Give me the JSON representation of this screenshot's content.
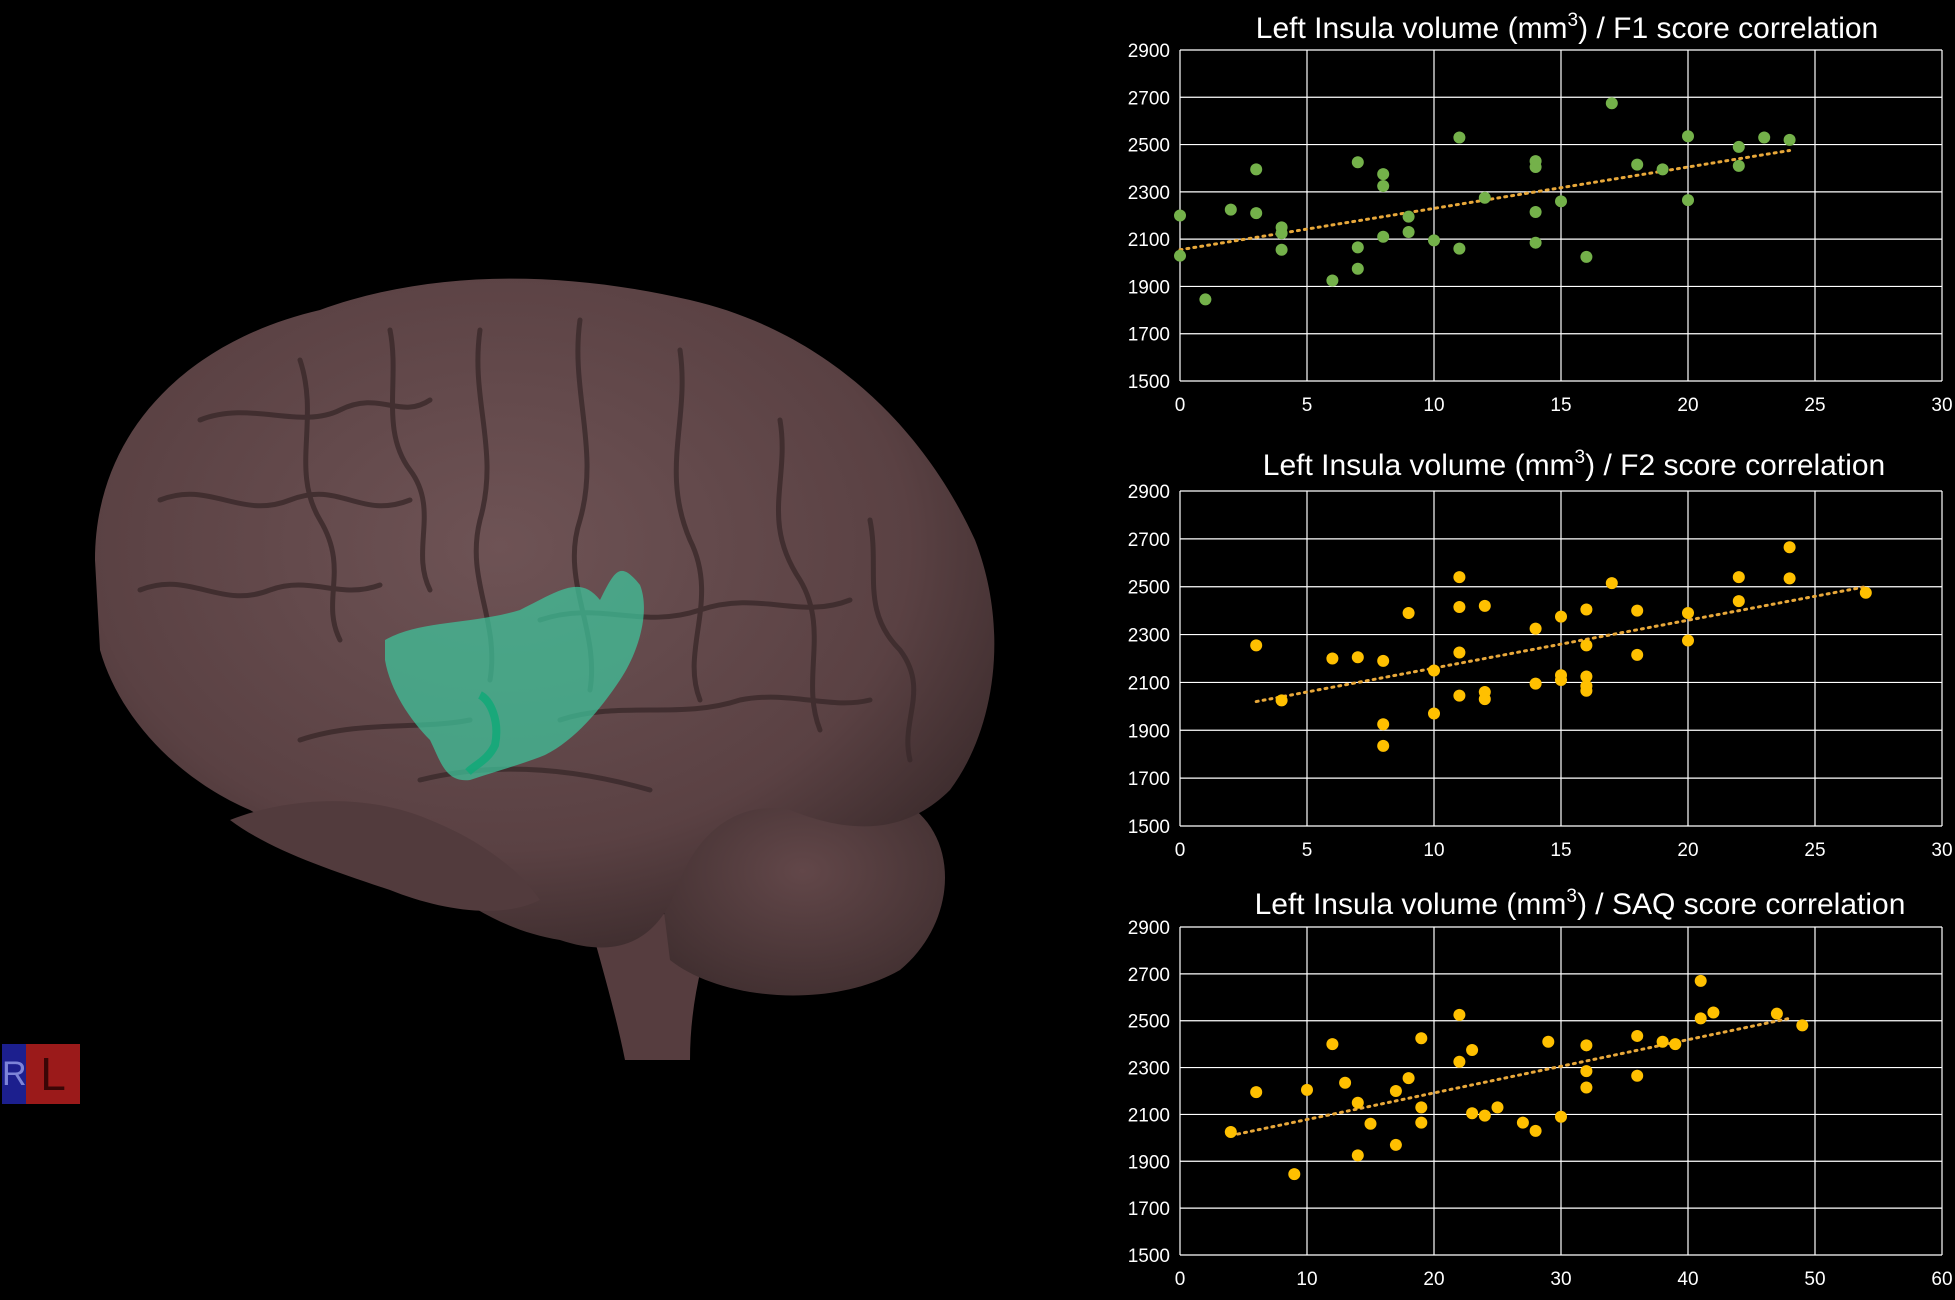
{
  "orientation_marker": {
    "right_letter": "R",
    "left_letter": "L"
  },
  "colors": {
    "background": "#000000",
    "brain": "#5e4446",
    "insula": "#3fc69d",
    "f1_points": "#74b14a",
    "yellow_points": "#ffc000",
    "trendline": "#e8a83a",
    "grid": "#ffffff"
  },
  "chart_data": [
    {
      "type": "scatter",
      "title_text": "Left Insula volume (mm",
      "title_sup": "3",
      "title_rest": ") / F1 score correlation",
      "xlabel": "",
      "ylabel": "",
      "xlim": [
        0,
        30
      ],
      "ylim": [
        1500,
        2900
      ],
      "xticks": [
        0,
        5,
        10,
        15,
        20,
        25,
        30
      ],
      "yticks": [
        1500,
        1700,
        1900,
        2100,
        2300,
        2500,
        2700,
        2900
      ],
      "grid": true,
      "marker_color": "#74b14a",
      "trendline": {
        "style": "dotted",
        "from": [
          0,
          2055
        ],
        "to": [
          24,
          2475
        ]
      },
      "points": [
        [
          0,
          2200
        ],
        [
          0,
          2030
        ],
        [
          1,
          1845
        ],
        [
          2,
          2225
        ],
        [
          3,
          2395
        ],
        [
          3,
          2210
        ],
        [
          4,
          2150
        ],
        [
          4,
          2125
        ],
        [
          4,
          2055
        ],
        [
          6,
          1925
        ],
        [
          7,
          2425
        ],
        [
          7,
          2065
        ],
        [
          7,
          1975
        ],
        [
          8,
          2375
        ],
        [
          8,
          2325
        ],
        [
          8,
          2110
        ],
        [
          9,
          2195
        ],
        [
          9,
          2130
        ],
        [
          10,
          2095
        ],
        [
          11,
          2530
        ],
        [
          11,
          2060
        ],
        [
          12,
          2275
        ],
        [
          14,
          2430
        ],
        [
          14,
          2405
        ],
        [
          14,
          2215
        ],
        [
          14,
          2085
        ],
        [
          15,
          2260
        ],
        [
          16,
          2025
        ],
        [
          17,
          2675
        ],
        [
          18,
          2415
        ],
        [
          19,
          2395
        ],
        [
          20,
          2535
        ],
        [
          20,
          2265
        ],
        [
          22,
          2490
        ],
        [
          22,
          2410
        ],
        [
          23,
          2530
        ],
        [
          24,
          2520
        ]
      ]
    },
    {
      "type": "scatter",
      "title_text": "Left Insula volume (mm",
      "title_sup": "3",
      "title_rest": ") / F2 score correlation",
      "xlabel": "",
      "ylabel": "",
      "xlim": [
        0,
        30
      ],
      "ylim": [
        1500,
        2900
      ],
      "xticks": [
        0,
        5,
        10,
        15,
        20,
        25,
        30
      ],
      "yticks": [
        1500,
        1700,
        1900,
        2100,
        2300,
        2500,
        2700,
        2900
      ],
      "grid": true,
      "marker_color": "#ffc000",
      "trendline": {
        "style": "dotted",
        "from": [
          3,
          2020
        ],
        "to": [
          27,
          2500
        ]
      },
      "points": [
        [
          3,
          2255
        ],
        [
          4,
          2025
        ],
        [
          6,
          2200
        ],
        [
          7,
          2205
        ],
        [
          8,
          2190
        ],
        [
          8,
          1925
        ],
        [
          8,
          1835
        ],
        [
          9,
          2390
        ],
        [
          10,
          2150
        ],
        [
          10,
          1970
        ],
        [
          11,
          2540
        ],
        [
          11,
          2415
        ],
        [
          11,
          2225
        ],
        [
          11,
          2045
        ],
        [
          12,
          2420
        ],
        [
          12,
          2060
        ],
        [
          12,
          2030
        ],
        [
          14,
          2325
        ],
        [
          14,
          2095
        ],
        [
          15,
          2375
        ],
        [
          15,
          2130
        ],
        [
          15,
          2110
        ],
        [
          16,
          2405
        ],
        [
          16,
          2255
        ],
        [
          16,
          2125
        ],
        [
          16,
          2085
        ],
        [
          16,
          2065
        ],
        [
          17,
          2515
        ],
        [
          18,
          2400
        ],
        [
          18,
          2215
        ],
        [
          20,
          2390
        ],
        [
          20,
          2275
        ],
        [
          22,
          2540
        ],
        [
          22,
          2440
        ],
        [
          24,
          2665
        ],
        [
          24,
          2535
        ],
        [
          27,
          2475
        ]
      ]
    },
    {
      "type": "scatter",
      "title_text": "Left Insula volume (mm",
      "title_sup": "3",
      "title_rest": ") / SAQ score correlation",
      "xlabel": "",
      "ylabel": "",
      "xlim": [
        0,
        60
      ],
      "ylim": [
        1500,
        2900
      ],
      "xticks": [
        0,
        10,
        20,
        30,
        40,
        50,
        60
      ],
      "yticks": [
        1500,
        1700,
        1900,
        2100,
        2300,
        2500,
        2700,
        2900
      ],
      "grid": true,
      "marker_color": "#ffc000",
      "trendline": {
        "style": "dotted",
        "from": [
          4,
          2010
        ],
        "to": [
          48,
          2510
        ]
      },
      "points": [
        [
          4,
          2025
        ],
        [
          6,
          2195
        ],
        [
          9,
          1845
        ],
        [
          10,
          2205
        ],
        [
          12,
          2400
        ],
        [
          13,
          2235
        ],
        [
          14,
          2150
        ],
        [
          14,
          1925
        ],
        [
          15,
          2060
        ],
        [
          17,
          2200
        ],
        [
          17,
          1970
        ],
        [
          18,
          2255
        ],
        [
          19,
          2425
        ],
        [
          19,
          2130
        ],
        [
          19,
          2065
        ],
        [
          22,
          2525
        ],
        [
          22,
          2325
        ],
        [
          23,
          2375
        ],
        [
          23,
          2105
        ],
        [
          24,
          2095
        ],
        [
          25,
          2130
        ],
        [
          27,
          2065
        ],
        [
          28,
          2030
        ],
        [
          29,
          2410
        ],
        [
          30,
          2090
        ],
        [
          32,
          2395
        ],
        [
          32,
          2285
        ],
        [
          32,
          2215
        ],
        [
          36,
          2435
        ],
        [
          36,
          2265
        ],
        [
          38,
          2410
        ],
        [
          39,
          2400
        ],
        [
          41,
          2670
        ],
        [
          41,
          2510
        ],
        [
          42,
          2535
        ],
        [
          47,
          2530
        ],
        [
          49,
          2480
        ]
      ]
    }
  ]
}
